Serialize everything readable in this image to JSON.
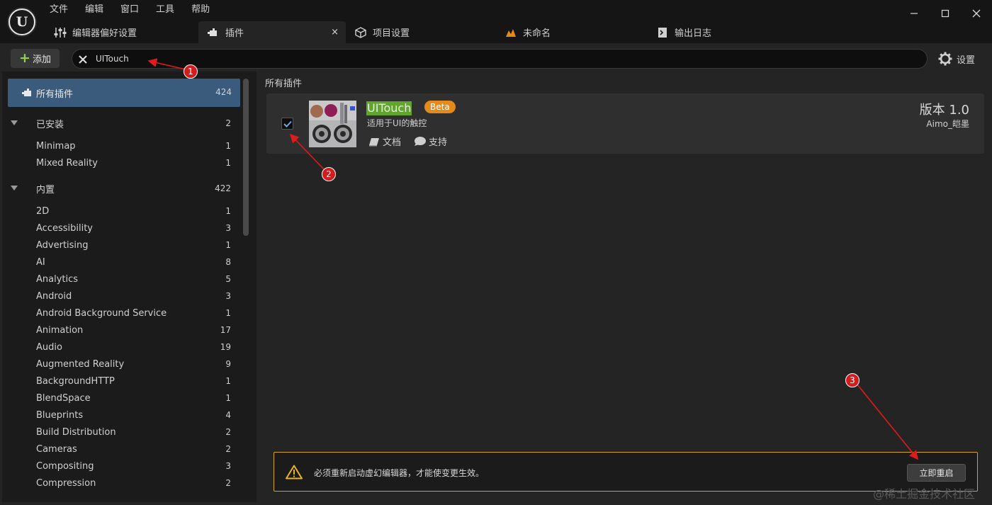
{
  "menubar": [
    "文件",
    "编辑",
    "窗口",
    "工具",
    "帮助"
  ],
  "tabs": [
    {
      "label": "编辑器偏好设置",
      "icon": "sliders-icon"
    },
    {
      "label": "插件",
      "icon": "plugin-icon",
      "close": "×"
    },
    {
      "label": "项目设置",
      "icon": "cube-icon"
    },
    {
      "label": "未命名",
      "icon": "level-icon"
    },
    {
      "label": "输出日志",
      "icon": "log-icon"
    }
  ],
  "toolbar": {
    "add_label": "添加",
    "search_value": "UITouch",
    "settings_label": "设置"
  },
  "sidebar": {
    "all": {
      "label": "所有插件",
      "count": "424"
    },
    "rows": [
      {
        "label": "已安装",
        "count": "2",
        "group": true
      },
      {
        "label": "Minimap",
        "count": "1"
      },
      {
        "label": "Mixed Reality",
        "count": "1"
      },
      {
        "label": "内置",
        "count": "422",
        "group": true
      },
      {
        "label": "2D",
        "count": "1"
      },
      {
        "label": "Accessibility",
        "count": "3"
      },
      {
        "label": "Advertising",
        "count": "1"
      },
      {
        "label": "AI",
        "count": "8"
      },
      {
        "label": "Analytics",
        "count": "5"
      },
      {
        "label": "Android",
        "count": "3"
      },
      {
        "label": "Android Background Service",
        "count": "1"
      },
      {
        "label": "Animation",
        "count": "17"
      },
      {
        "label": "Audio",
        "count": "19"
      },
      {
        "label": "Augmented Reality",
        "count": "9"
      },
      {
        "label": "BackgroundHTTP",
        "count": "1"
      },
      {
        "label": "BlendSpace",
        "count": "1"
      },
      {
        "label": "Blueprints",
        "count": "4"
      },
      {
        "label": "Build Distribution",
        "count": "2"
      },
      {
        "label": "Cameras",
        "count": "2"
      },
      {
        "label": "Compositing",
        "count": "3"
      },
      {
        "label": "Compression",
        "count": "2"
      }
    ]
  },
  "main": {
    "title": "所有插件",
    "plugin": {
      "name": "UITouch",
      "badge": "Beta",
      "description": "适用于UI的触控",
      "docs_label": "文档",
      "support_label": "支持",
      "version": "版本 1.0",
      "author": "Aimo_皑墨",
      "enabled": true
    }
  },
  "restart": {
    "message": "必须重新启动虚幻编辑器，才能使变更生效。",
    "button": "立即重启"
  },
  "annotations": [
    "1",
    "2",
    "3"
  ],
  "watermark": "@稀土掘金技术社区",
  "colors": {
    "selection": "#3a5b7c",
    "highlight": "#62a52c",
    "badge": "#e48a1a",
    "warning_border": "#d6a41a",
    "annotation": "#d11d1d"
  }
}
